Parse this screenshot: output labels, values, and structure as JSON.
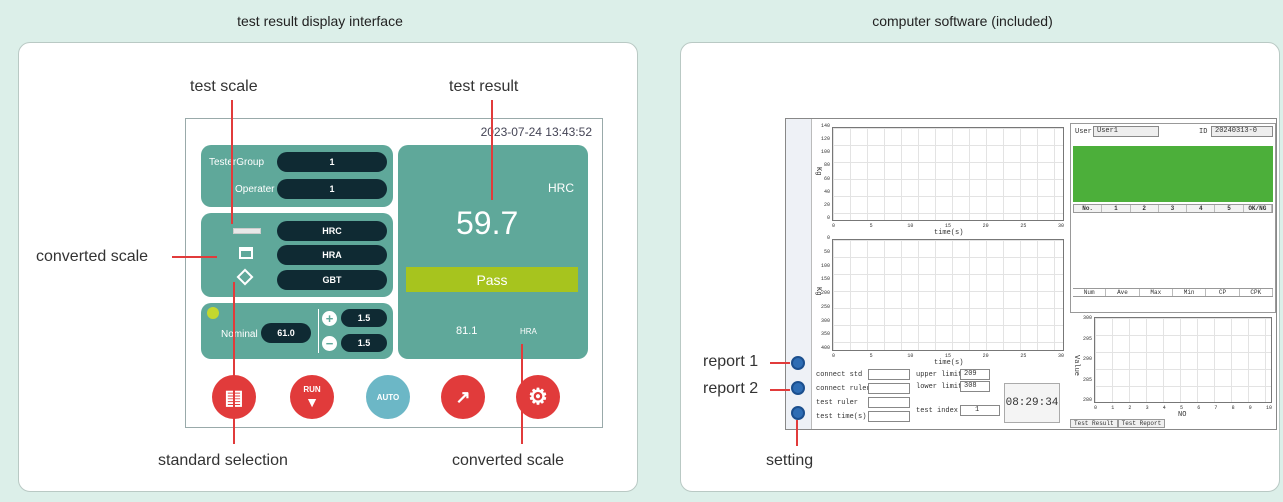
{
  "headings": {
    "left": "test result display interface",
    "right": "computer software (included)"
  },
  "device": {
    "datetime": "2023-07-24 13:43:52",
    "tester_group_label": "TesterGroup",
    "tester_group_value": "1",
    "operater_label": "Operater",
    "operater_value": "1",
    "scales": [
      "HRC",
      "HRA",
      "GBT"
    ],
    "nominal_label": "Nominal",
    "nominal_value": "61.0",
    "plus_value": "1.5",
    "minus_value": "1.5",
    "result_scale": "HRC",
    "result_value": "59.7",
    "status": "Pass",
    "converted_value": "81.1",
    "converted_scale": "HRA",
    "buttons": {
      "run": "RUN",
      "auto": "AUTO"
    }
  },
  "device_callouts": {
    "test_scale": "test scale",
    "test_result": "test result",
    "converted_scale_left": "converted scale",
    "standard_selection": "standard selection",
    "converted_scale_bottom": "converted scale"
  },
  "software_callouts": {
    "report1": "report 1",
    "report2": "report 2",
    "setting": "setting"
  },
  "software": {
    "user_label": "User",
    "user_value": "User1",
    "id_label": "ID",
    "id_value": "20240313-0",
    "result_table_headers": [
      "No.",
      "1",
      "2",
      "3",
      "4",
      "5",
      "OK/NG"
    ],
    "stats_headers": [
      "Num",
      "Ave",
      "Max",
      "Min",
      "CP",
      "CPK"
    ],
    "chart1_ylabel": "Kg",
    "chart1_xlabel": "time(s)",
    "chart1_yticks": [
      "140",
      "120",
      "100",
      "80",
      "60",
      "40",
      "20",
      "0"
    ],
    "chart2_ylabel": "Kg",
    "chart2_xlabel": "time(s)",
    "chart2_yticks": [
      "0",
      "50",
      "100",
      "150",
      "200",
      "250",
      "300",
      "350",
      "400"
    ],
    "xticks": [
      "0",
      "5",
      "10",
      "15",
      "20",
      "25",
      "30"
    ],
    "chart3_ylabel": "Value",
    "chart3_xlabel": "NO",
    "chart3_yticks": [
      "300",
      "295",
      "290",
      "285",
      "280"
    ],
    "chart3_xticks": [
      "0",
      "1",
      "2",
      "3",
      "4",
      "5",
      "6",
      "7",
      "8",
      "9",
      "10"
    ],
    "form": {
      "connect_std": "connect std",
      "connect_ruler": "connect ruler",
      "test_ruler": "test ruler",
      "test_times": "test time(s)",
      "upper_limit_label": "upper limit",
      "upper_limit": "209",
      "lower_limit_label": "lower limit",
      "lower_limit": "308",
      "test_index_label": "test index",
      "test_index": "1"
    },
    "clock": "08:29:34",
    "tabs": [
      "Test Result",
      "Test Report"
    ]
  },
  "colors": {
    "teal": "#5fa89a",
    "pass": "#a7c41e",
    "green_status": "#4caf3a",
    "red_btn": "#e13b3b"
  }
}
